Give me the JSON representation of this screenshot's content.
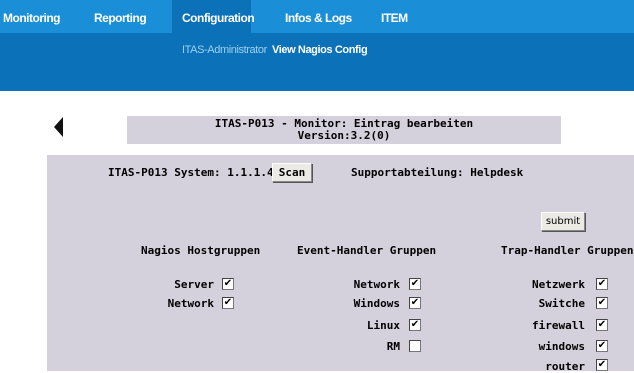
{
  "nav": {
    "items": [
      "Monitoring",
      "Reporting",
      "Configuration",
      "Infos & Logs",
      "ITEM"
    ],
    "active": "Configuration",
    "sub": [
      "ITAS-Administrator",
      "View Nagios Config"
    ]
  },
  "header": {
    "title": "ITAS-P013 - Monitor: Eintrag bearbeiten",
    "version": "Version:3.2(0)"
  },
  "system": {
    "label": "ITAS-P013 System: 1.1.1.4",
    "scan_label": "Scan",
    "support": "Supportabteilung: Helpdesk"
  },
  "submit_label": "submit",
  "groups": {
    "nagios": {
      "title": "Nagios Hostgruppen",
      "items": [
        {
          "label": "Server",
          "checked": true
        },
        {
          "label": "Network",
          "checked": true
        }
      ]
    },
    "event": {
      "title": "Event-Handler Gruppen",
      "items": [
        {
          "label": "Network",
          "checked": true
        },
        {
          "label": "Windows",
          "checked": true
        },
        {
          "label": "Linux",
          "checked": true
        },
        {
          "label": "RM",
          "checked": false
        }
      ]
    },
    "trap": {
      "title": "Trap-Handler Gruppen",
      "items": [
        {
          "label": "Netzwerk",
          "checked": true
        },
        {
          "label": "Switche",
          "checked": true
        },
        {
          "label": "firewall",
          "checked": true
        },
        {
          "label": "windows",
          "checked": true
        },
        {
          "label": "router",
          "checked": true
        }
      ]
    }
  },
  "colors": {
    "topbar": "#1a8fd8",
    "subbar": "#0b71b8",
    "panel": "#d4d0dc",
    "sub_active": "#9fd0f0"
  }
}
